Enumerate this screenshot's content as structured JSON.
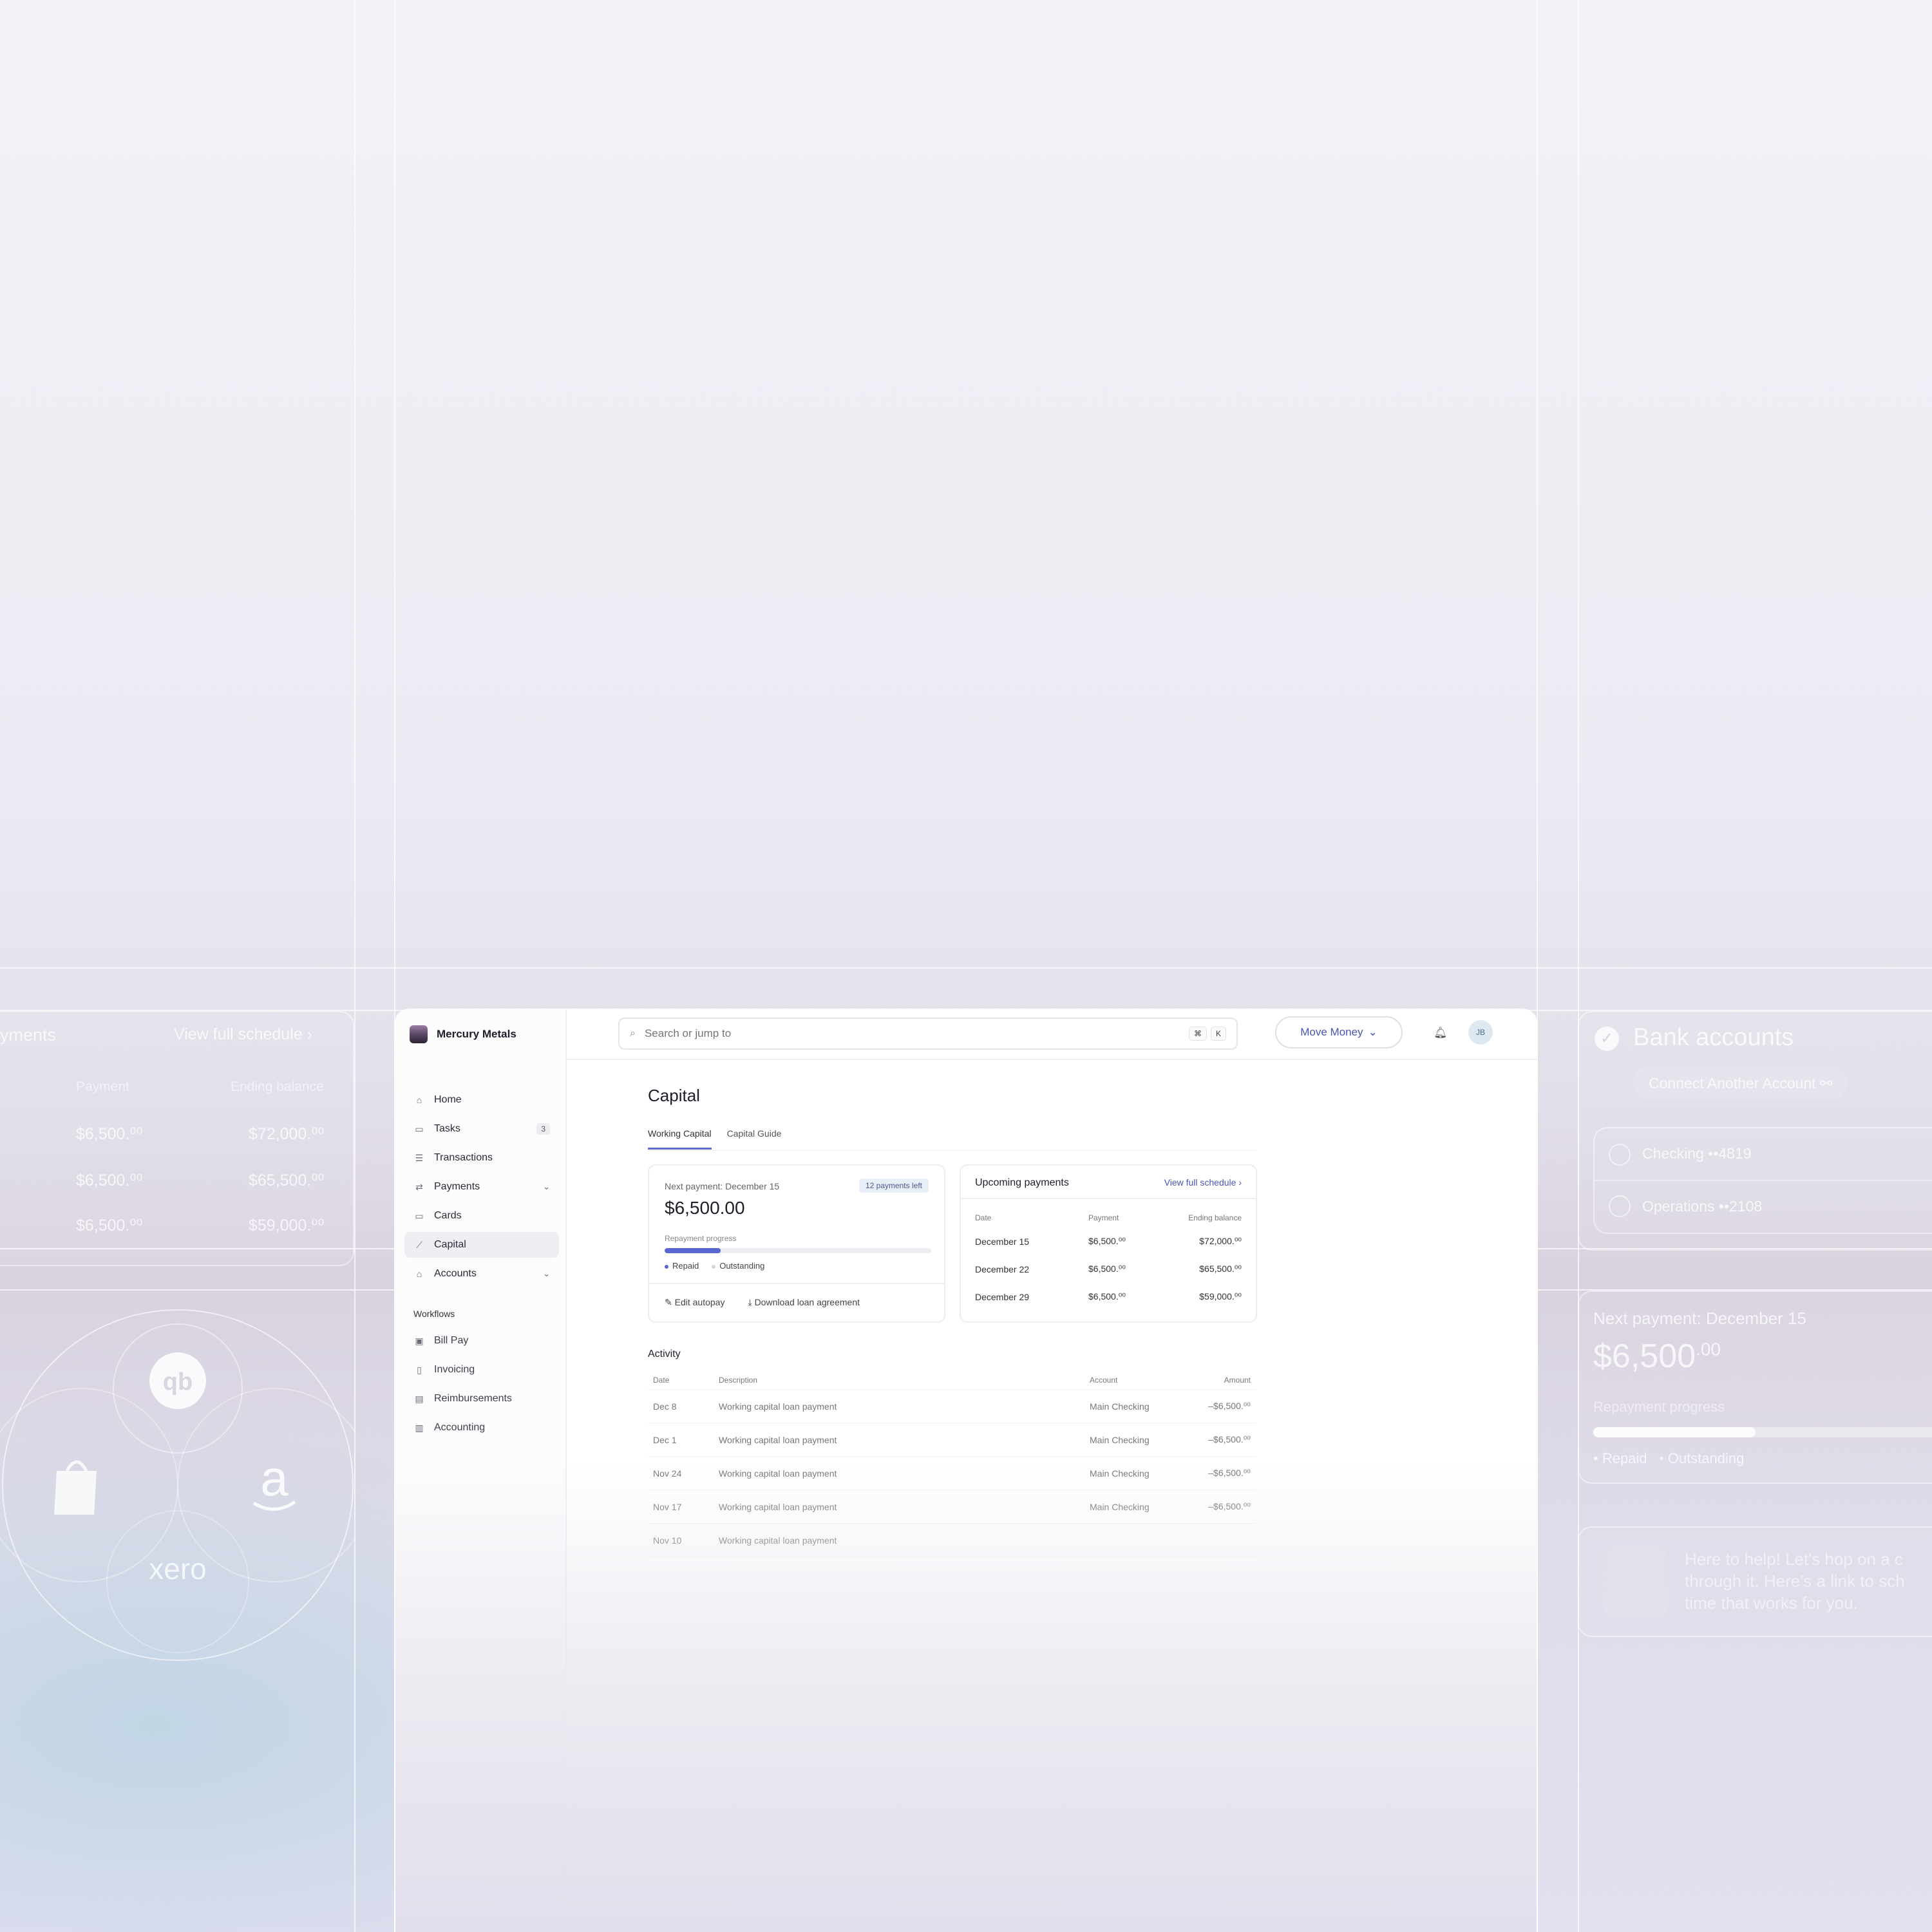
{
  "sidebar": {
    "brand": "Mercury Metals",
    "items": [
      {
        "label": "Home",
        "icon": "home-icon"
      },
      {
        "label": "Tasks",
        "icon": "tasks-icon",
        "badge": "3"
      },
      {
        "label": "Transactions",
        "icon": "list-icon"
      },
      {
        "label": "Payments",
        "icon": "transfer-icon"
      },
      {
        "label": "Cards",
        "icon": "card-icon"
      },
      {
        "label": "Capital",
        "icon": "chart-icon",
        "active": true
      },
      {
        "label": "Accounts",
        "icon": "bank-icon"
      }
    ],
    "section_title": "Workflows",
    "workflows": [
      {
        "label": "Bill Pay"
      },
      {
        "label": "Invoicing"
      },
      {
        "label": "Reimbursements"
      },
      {
        "label": "Accounting"
      }
    ]
  },
  "topbar": {
    "search_placeholder": "Search or jump to",
    "kbd1": "⌘",
    "kbd2": "K",
    "move_money": "Move Money",
    "avatar": "JB"
  },
  "main": {
    "title": "Capital",
    "tabs": [
      "Working Capital",
      "Capital Guide"
    ],
    "next_payment": {
      "label": "Next payment: December 15",
      "badge": "12 payments left",
      "amount": "$6,500.00",
      "progress_label": "Repayment progress",
      "progress": 0.21,
      "legend_repaid": "Repaid",
      "legend_outstanding": "Outstanding",
      "edit_autopay": "Edit autopay",
      "download": "Download loan agreement"
    },
    "upcoming": {
      "title": "Upcoming payments",
      "link": "View full schedule",
      "headers": [
        "Date",
        "Payment",
        "Ending balance"
      ],
      "rows": [
        [
          "December 15",
          "$6,500.⁰⁰",
          "$72,000.⁰⁰"
        ],
        [
          "December 22",
          "$6,500.⁰⁰",
          "$65,500.⁰⁰"
        ],
        [
          "December 29",
          "$6,500.⁰⁰",
          "$59,000.⁰⁰"
        ]
      ]
    },
    "activity": {
      "title": "Activity",
      "headers": [
        "Date",
        "Description",
        "Account",
        "Amount"
      ],
      "rows": [
        [
          "Dec 8",
          "Working capital loan payment",
          "Main Checking",
          "–$6,500.⁰⁰"
        ],
        [
          "Dec 1",
          "Working capital loan payment",
          "Main Checking",
          "–$6,500.⁰⁰"
        ],
        [
          "Nov 24",
          "Working capital loan payment",
          "Main Checking",
          "–$6,500.⁰⁰"
        ],
        [
          "Nov 17",
          "Working capital loan payment",
          "Main Checking",
          "–$6,500.⁰⁰"
        ],
        [
          "Nov 10",
          "Working capital loan payment",
          "",
          ""
        ]
      ]
    }
  },
  "ghost_left": {
    "heading": "yments",
    "link": "View full schedule",
    "headers": [
      "Payment",
      "Ending balance"
    ],
    "rows": [
      [
        "$6,500.⁰⁰",
        "$72,000.⁰⁰"
      ],
      [
        "$6,500.⁰⁰",
        "$65,500.⁰⁰"
      ],
      [
        "$6,500.⁰⁰",
        "$59,000.⁰⁰"
      ]
    ],
    "integrations": [
      "qb",
      "xero"
    ]
  },
  "ghost_right": {
    "bank_title": "Bank accounts",
    "connect": "Connect Another Account",
    "accounts": [
      "Checking ••4819",
      "Operations ••2108"
    ],
    "next_payment": "Next payment: December 15",
    "amount": "$6,500",
    "amount_cents": ".00",
    "progress_label": "Repayment progress",
    "progress": 0.45,
    "legend_repaid": "Repaid",
    "legend_outstanding": "Outstanding",
    "chat": [
      "Here to help! Let's hop on a c",
      "through it. Here's a link to sch",
      "time that works for you."
    ]
  }
}
